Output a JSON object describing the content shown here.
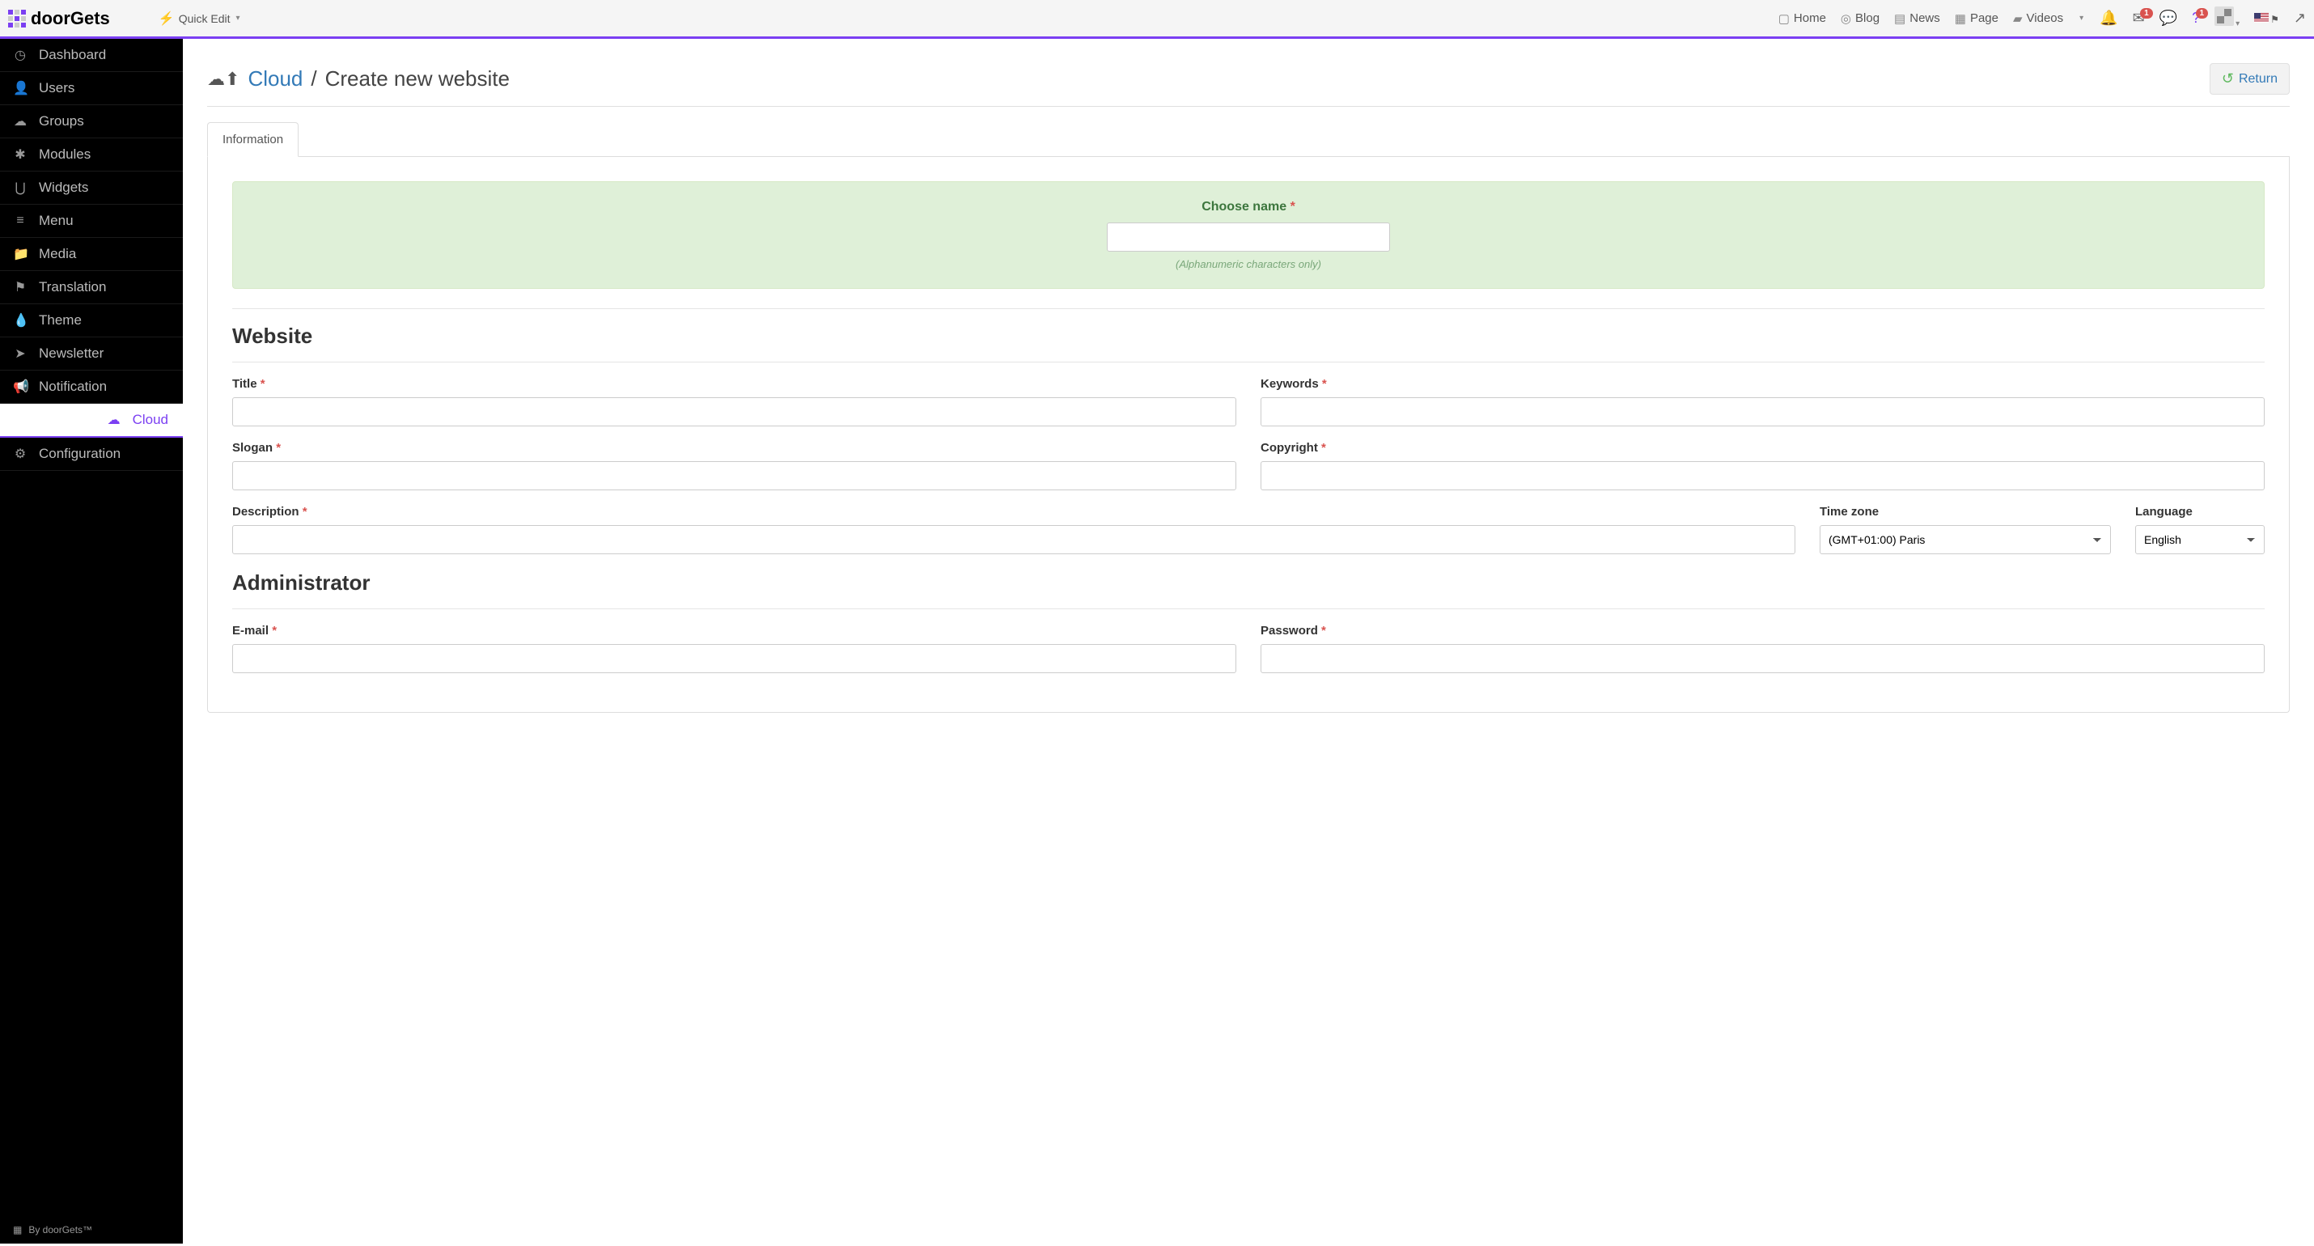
{
  "brand": "doorGets",
  "quick_edit": "Quick Edit",
  "top_nav": {
    "home": "Home",
    "blog": "Blog",
    "news": "News",
    "page": "Page",
    "videos": "Videos"
  },
  "badges": {
    "mail": "1",
    "help": "1"
  },
  "sidebar": {
    "items": [
      {
        "label": "Dashboard",
        "icon": "◷"
      },
      {
        "label": "Users",
        "icon": "👤"
      },
      {
        "label": "Groups",
        "icon": "☁"
      },
      {
        "label": "Modules",
        "icon": "✱"
      },
      {
        "label": "Widgets",
        "icon": "⋃"
      },
      {
        "label": "Menu",
        "icon": "≡"
      },
      {
        "label": "Media",
        "icon": "📁"
      },
      {
        "label": "Translation",
        "icon": "⚑"
      },
      {
        "label": "Theme",
        "icon": "💧"
      },
      {
        "label": "Newsletter",
        "icon": "➤"
      },
      {
        "label": "Notification",
        "icon": "📢"
      },
      {
        "label": "Cloud",
        "icon": "☁"
      },
      {
        "label": "Configuration",
        "icon": "⚙"
      }
    ],
    "footer": "By doorGets™"
  },
  "breadcrumb": {
    "link": "Cloud",
    "sep": "/",
    "current": "Create new website"
  },
  "return_label": "Return",
  "tabs": {
    "information": "Information"
  },
  "choose_name": {
    "label": "Choose name",
    "hint": "(Alphanumeric characters only)"
  },
  "sections": {
    "website": "Website",
    "administrator": "Administrator"
  },
  "fields": {
    "title": "Title",
    "keywords": "Keywords",
    "slogan": "Slogan",
    "copyright": "Copyright",
    "description": "Description",
    "timezone": "Time zone",
    "language": "Language",
    "email": "E-mail",
    "password": "Password"
  },
  "values": {
    "timezone": "(GMT+01:00) Paris",
    "language": "English"
  }
}
